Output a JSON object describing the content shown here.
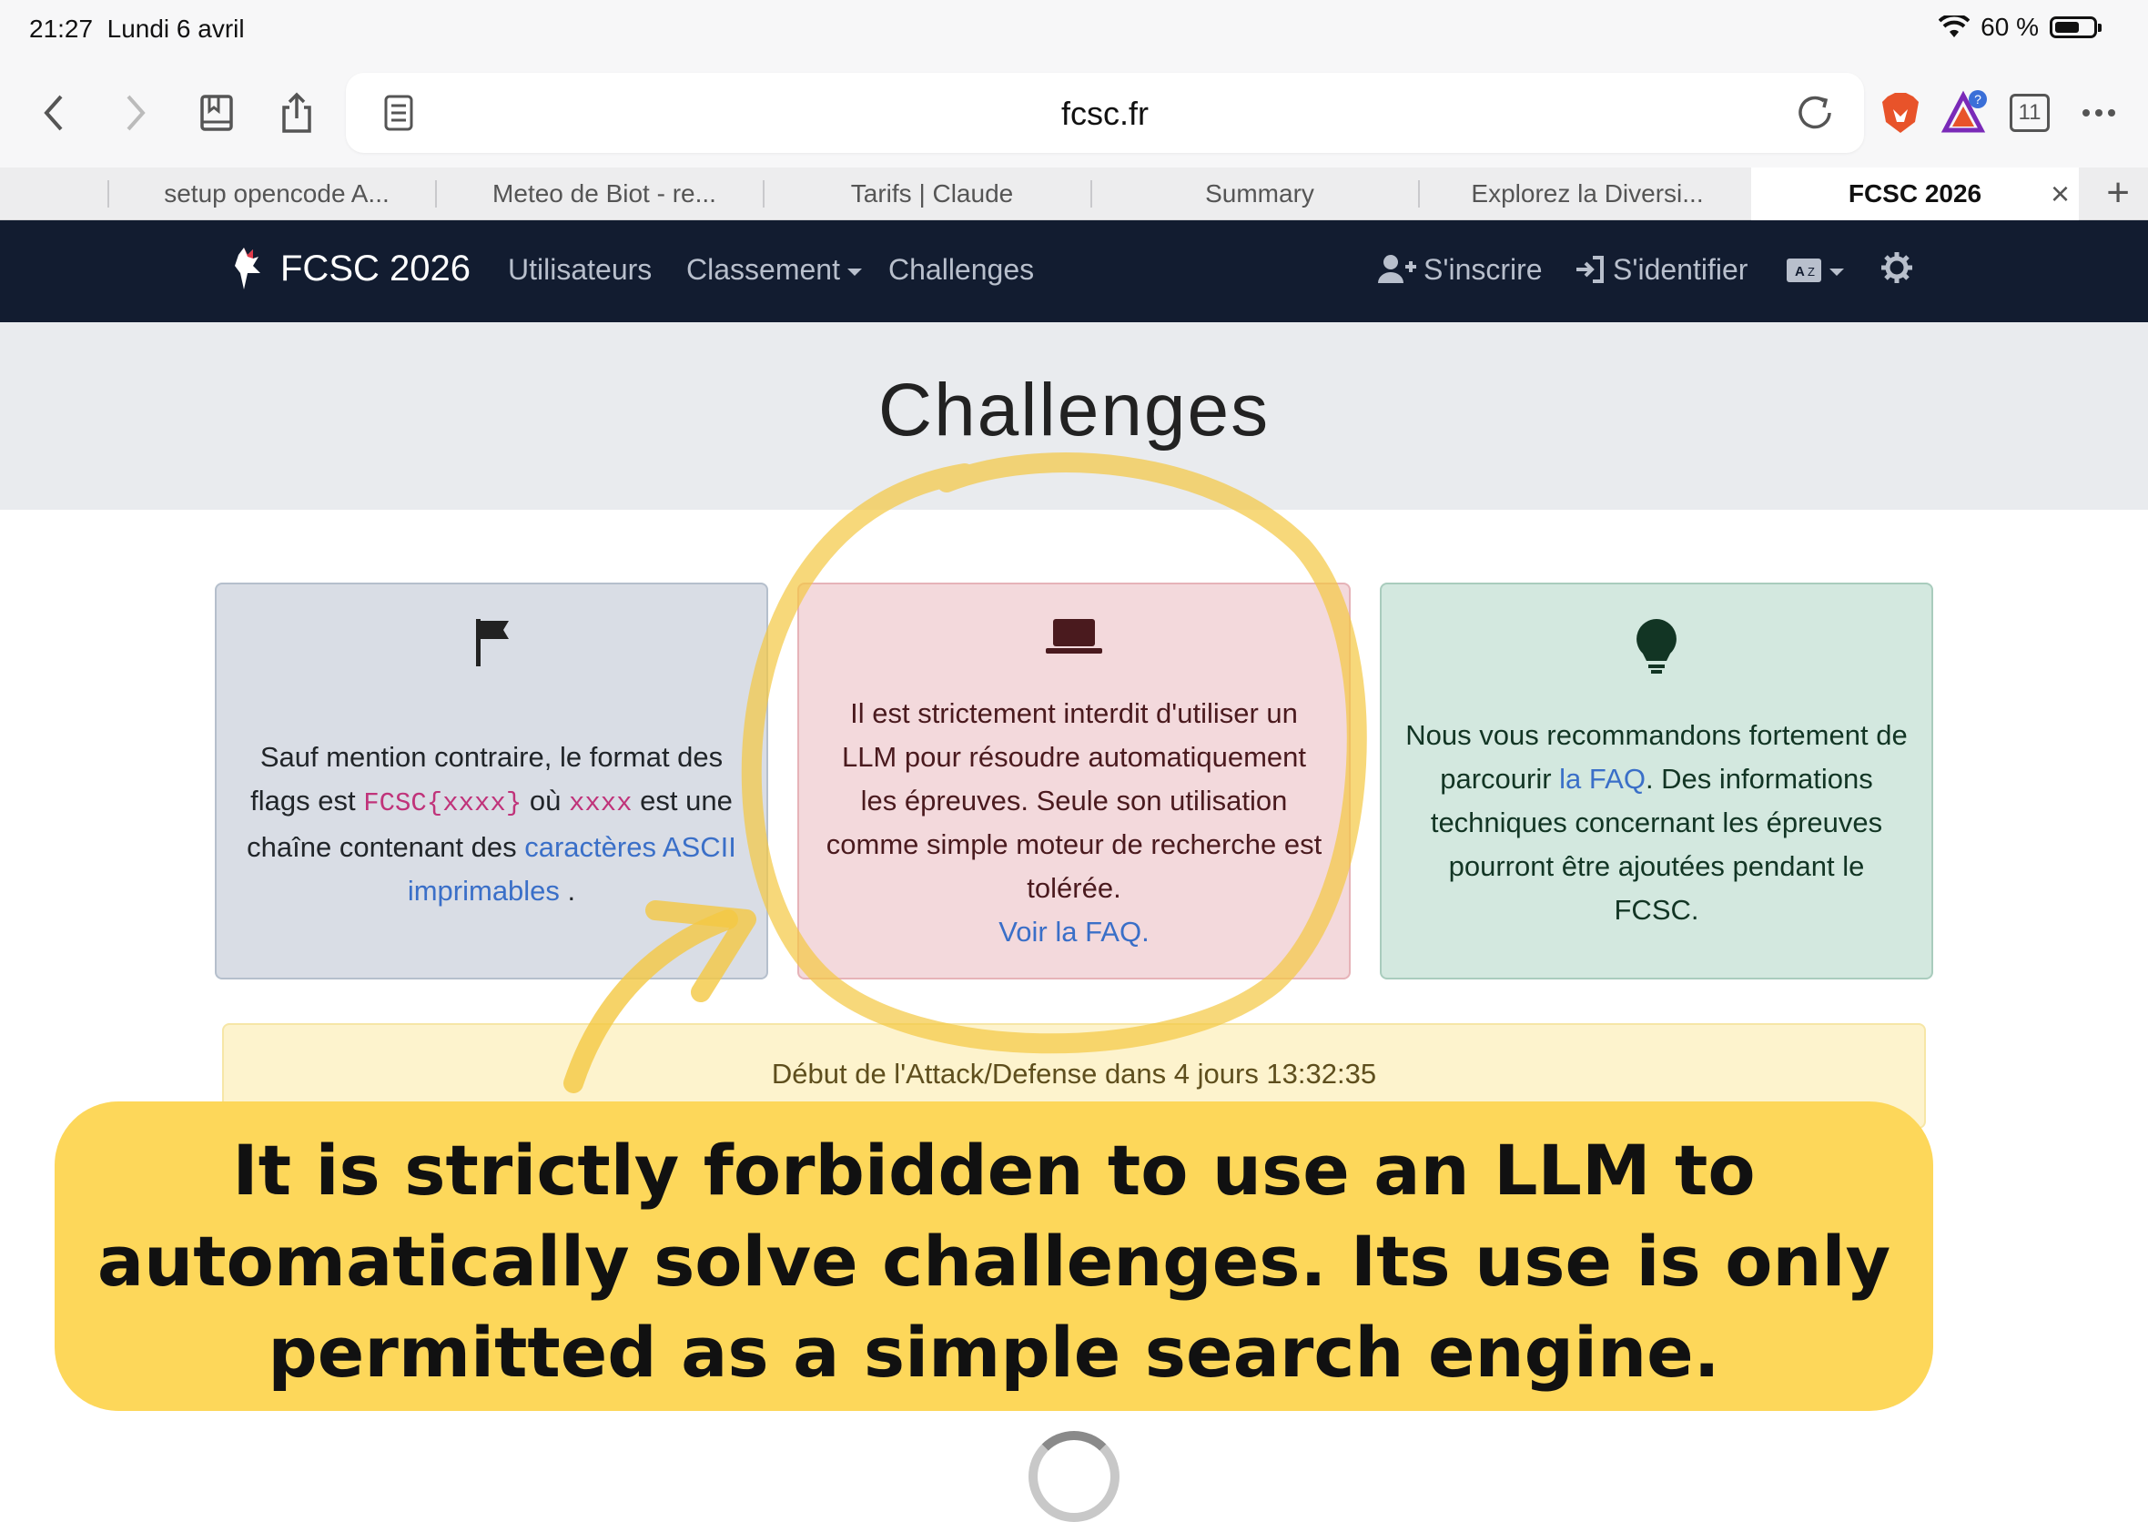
{
  "status_bar": {
    "time": "21:27",
    "date": "Lundi 6 avril",
    "battery": "60 %"
  },
  "browser": {
    "url": "fcsc.fr",
    "tab_count": "11",
    "tabs": [
      {
        "label": "setup opencode A..."
      },
      {
        "label": "Meteo de Biot - re..."
      },
      {
        "label": "Tarifs | Claude"
      },
      {
        "label": "Summary"
      },
      {
        "label": "Explorez la Diversi..."
      },
      {
        "label": "FCSC 2026"
      }
    ],
    "close_glyph": "×",
    "new_tab_glyph": "+"
  },
  "navbar": {
    "brand": "FCSC 2026",
    "links": {
      "users": "Utilisateurs",
      "ranking": "Classement",
      "challenges": "Challenges",
      "register": "S'inscrire",
      "login": "S'identifier"
    }
  },
  "hero": {
    "title": "Challenges"
  },
  "cards": {
    "flag": {
      "icon": "flag-icon",
      "text_1": "Sauf mention contraire, le format des flags est ",
      "code_1": "FCSC{xxxx}",
      "text_2": " où ",
      "code_2": "xxxx",
      "text_3": " est une chaîne contenant des ",
      "link": "caractères ASCII imprimables",
      "text_4": " ."
    },
    "llm": {
      "icon": "laptop-icon",
      "text": "Il est strictement interdit d'utiliser un LLM pour résoudre automatiquement les épreuves. Seule son utilisation comme simple moteur de recherche est tolérée.",
      "link": "Voir la FAQ."
    },
    "faq": {
      "icon": "lightbulb-icon",
      "text_1": "Nous vous recommandons fortement de parcourir ",
      "link": "la FAQ",
      "text_2": ". Des informations techniques concernant les épreuves pourront être ajoutées pendant le FCSC."
    }
  },
  "countdown": {
    "text": "Début de l'Attack/Defense dans 4 jours 13:32:35"
  },
  "callout": {
    "text": "It is strictly forbidden to use an LLM to automatically solve challenges. Its use is only permitted as a simple search engine."
  },
  "colors": {
    "navbar": "#121c30",
    "highlight": "#fdd75a",
    "link": "#3a6fc8",
    "code": "#c0337a"
  }
}
